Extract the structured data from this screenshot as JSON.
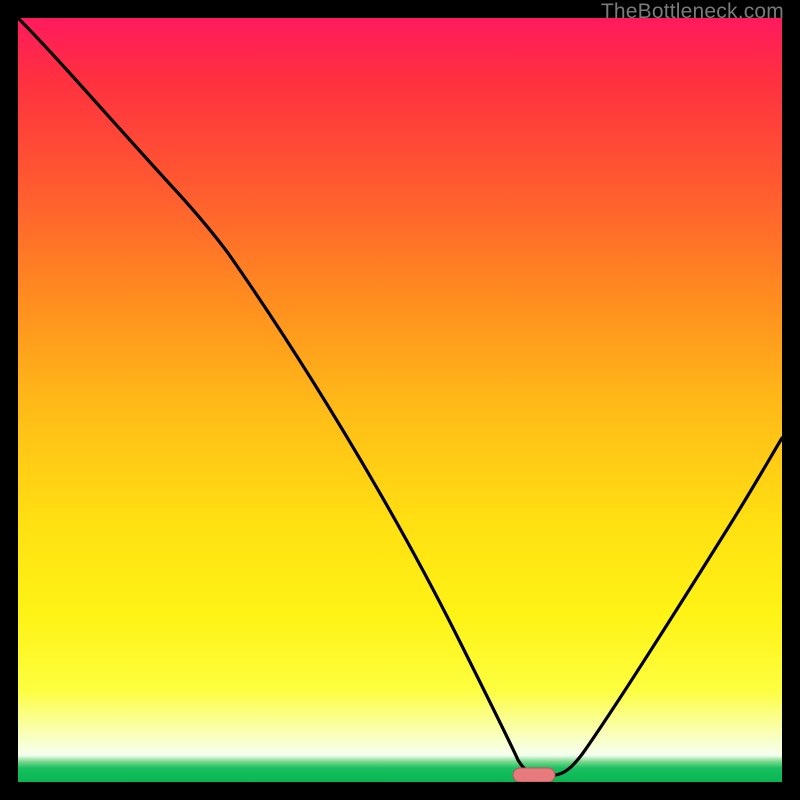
{
  "watermark": "TheBottleneck.com",
  "colors": {
    "frame": "#000000",
    "curve": "#000000",
    "marker_fill": "#e77a7d",
    "marker_stroke": "#c45055",
    "gradient_stops": [
      "#ff1a5e",
      "#ff3040",
      "#ff5a30",
      "#ff8a20",
      "#ffb818",
      "#ffe012",
      "#fff315",
      "#fdfe40",
      "#fbff8a",
      "#f9ffc8",
      "#f5fff0",
      "#7dd98f",
      "#18c060",
      "#09b552"
    ]
  },
  "chart_data": {
    "type": "line",
    "title": "",
    "xlabel": "",
    "ylabel": "",
    "xlim": [
      0,
      100
    ],
    "ylim": [
      0,
      100
    ],
    "grid": false,
    "legend": false,
    "series": [
      {
        "name": "bottleneck-curve",
        "x": [
          0,
          6,
          12,
          18,
          22,
          28,
          35,
          42,
          48,
          54,
          58,
          62,
          64,
          66,
          68,
          70,
          73,
          76,
          80,
          86,
          92,
          100
        ],
        "y": [
          100,
          93,
          85,
          78,
          72,
          64,
          54,
          44,
          35,
          25,
          17,
          10,
          5,
          2,
          0.5,
          0.5,
          3,
          8,
          15,
          26,
          39,
          57
        ]
      }
    ],
    "markers": [
      {
        "name": "optimal-range-marker",
        "shape": "pill",
        "x_start": 64.5,
        "x_end": 69.5,
        "y": 0.5
      }
    ],
    "_note": "x/y are percentages of the plotting area (0 at left/bottom, 100 at right/top). The curve descends steeply from top-left, flattens to a minimum near x≈66–70 at the bottom, then rises toward the right. A salmon pill marker sits at the trough on the baseline."
  }
}
